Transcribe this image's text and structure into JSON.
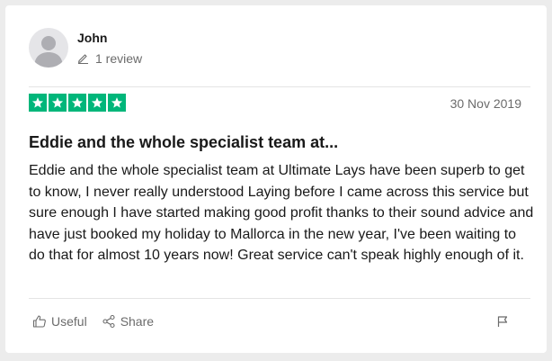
{
  "reviewer": {
    "name": "John",
    "review_count": "1 review",
    "avatar_icon": "user-silhouette-icon"
  },
  "rating": {
    "stars": 5,
    "max_stars": 5,
    "color": "#00b67a"
  },
  "date": "30 Nov 2019",
  "review": {
    "title": "Eddie and the whole specialist team at...",
    "text": "Eddie and the whole specialist team at Ultimate Lays have been superb to get to know, I never really understood Laying before I came across this service but sure enough I have started making good profit thanks to their sound advice and have just booked my holiday to Mallorca in the new year, I've been waiting to do that for almost 10 years now! Great service can't speak highly enough of it."
  },
  "actions": {
    "useful_label": "Useful",
    "share_label": "Share",
    "useful_icon": "thumbs-up-icon",
    "share_icon": "share-icon",
    "flag_icon": "flag-icon"
  }
}
